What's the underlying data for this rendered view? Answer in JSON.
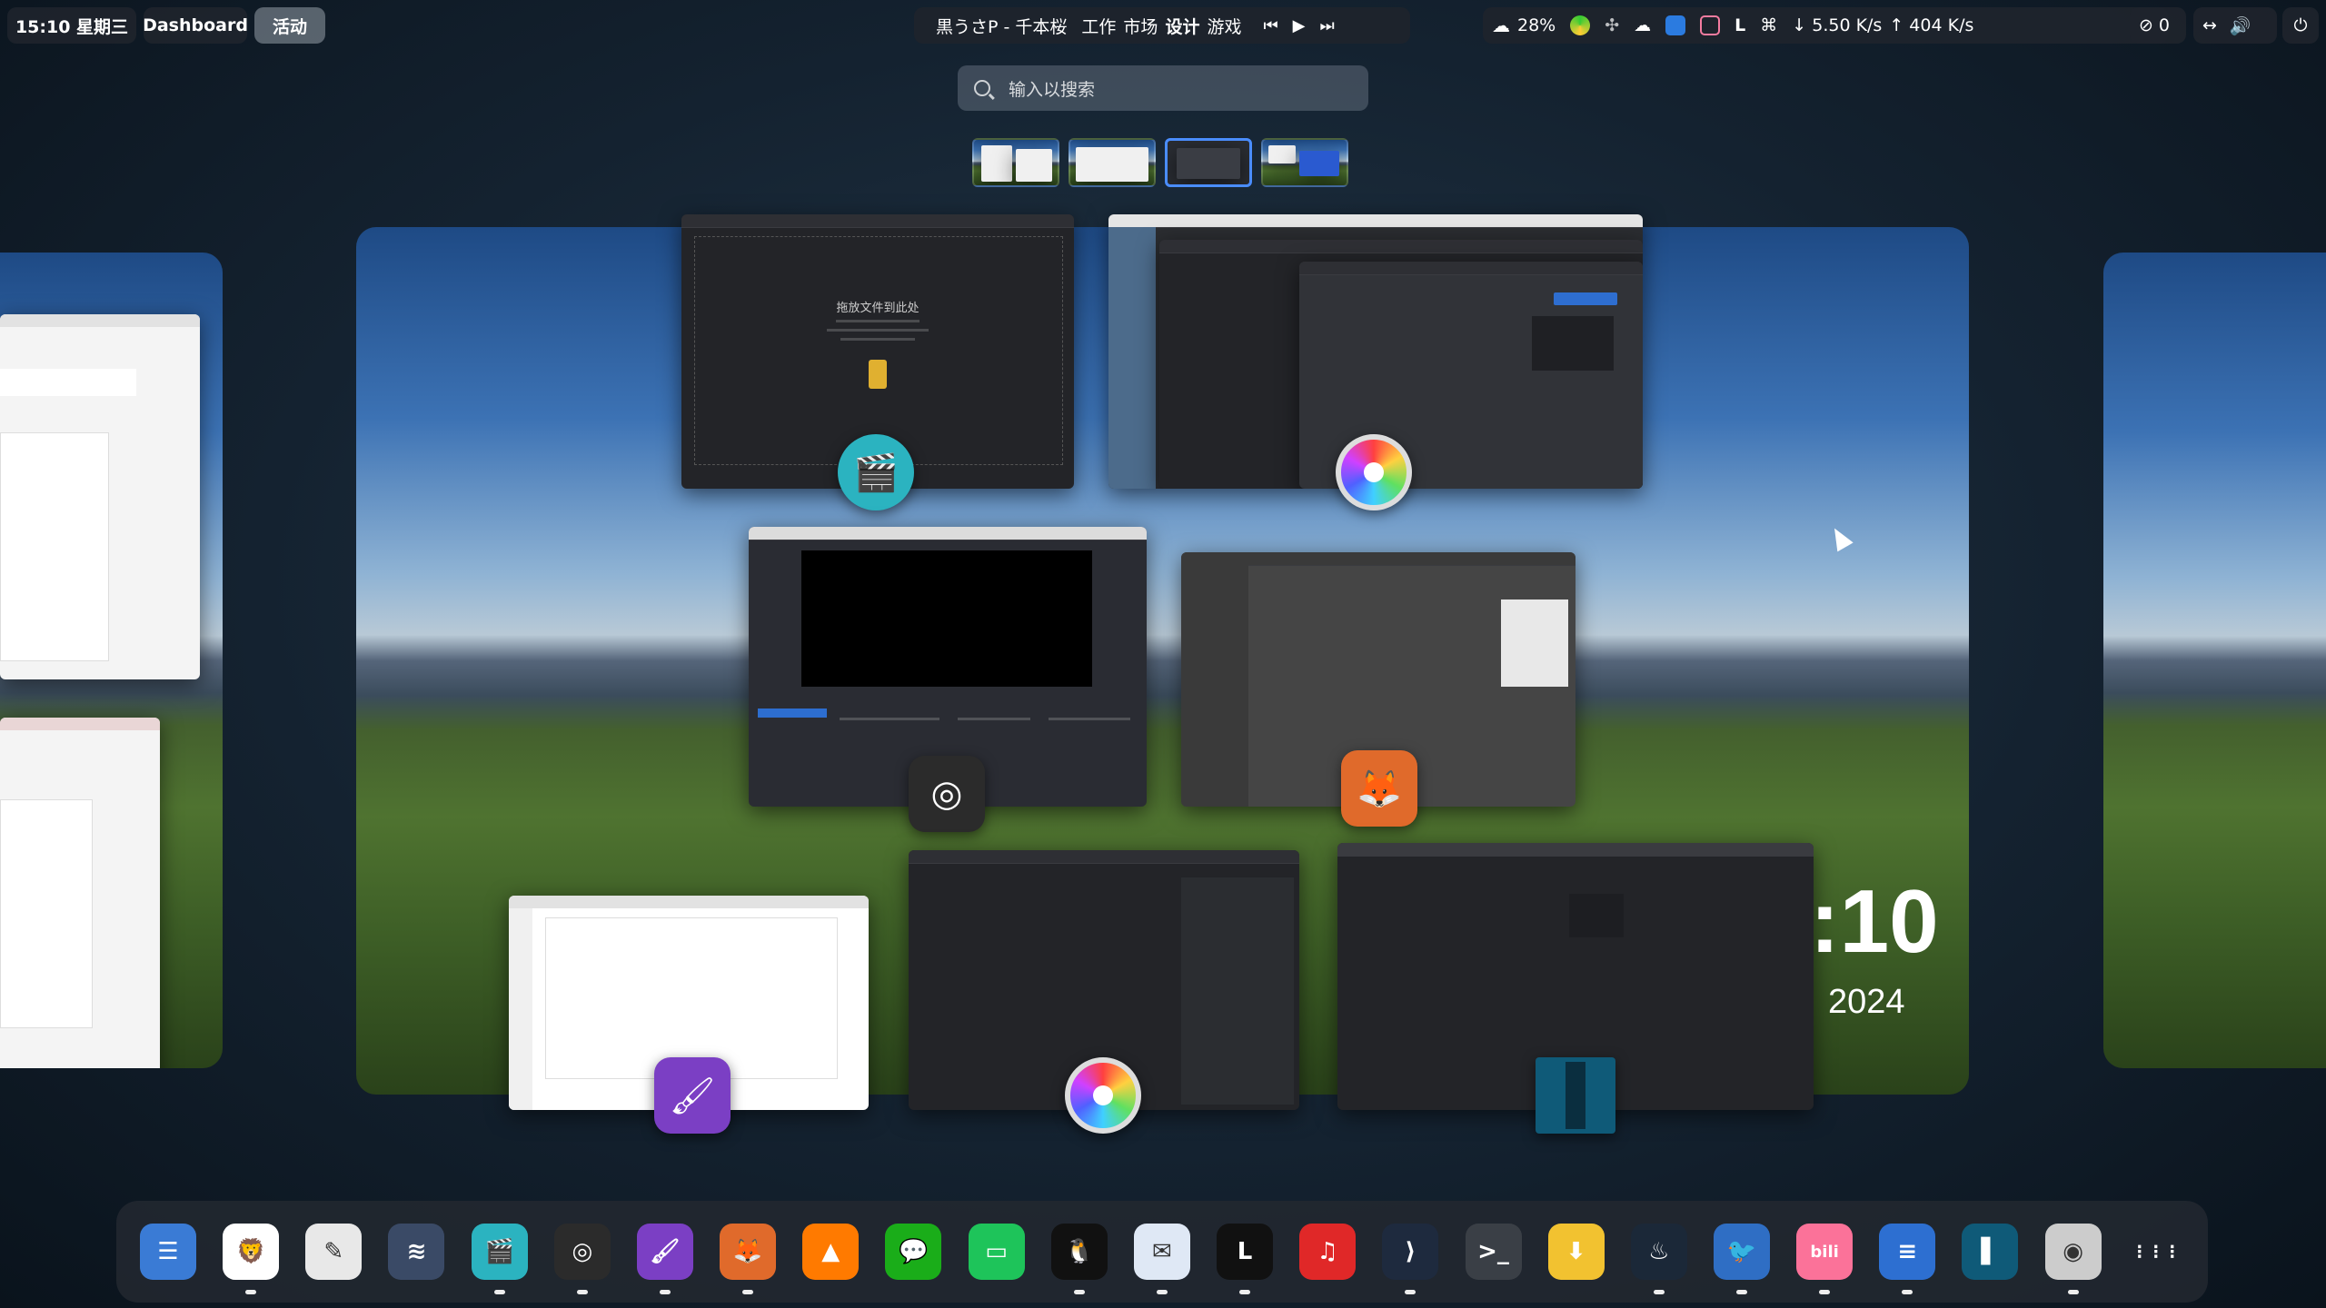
{
  "topbar": {
    "datetime": "15:10 星期三",
    "dashboard": "Dashboard",
    "activities": "活动",
    "now_playing": "黒うさP - 千本桜",
    "workspaces": [
      "工作",
      "市场",
      "设计",
      "游戏"
    ],
    "battery": "28%",
    "net_down": "↓ 5.50 K/s",
    "net_up": "↑ 404 K/s",
    "notif_count": "0"
  },
  "search": {
    "placeholder": "输入以搜索"
  },
  "clock": {
    "time": ":10",
    "year": "2024"
  },
  "windows": {
    "video_editor": {
      "drop_title": "拖放文件到此处",
      "icon": "clapperboard-icon"
    }
  },
  "dock": {
    "items": [
      {
        "name": "finder-icon",
        "color": "#3a7bd5",
        "glyph": "☰",
        "running": false
      },
      {
        "name": "brave-icon",
        "color": "#ffffff",
        "glyph": "🦁",
        "running": true
      },
      {
        "name": "notes-icon",
        "color": "#e8e8e8",
        "glyph": "✎",
        "running": false
      },
      {
        "name": "layers-icon",
        "color": "#3a4a66",
        "glyph": "≋",
        "running": false
      },
      {
        "name": "video-editor-icon",
        "color": "#2bb3c0",
        "glyph": "🎬",
        "running": true
      },
      {
        "name": "obs-icon",
        "color": "#2b2b2b",
        "glyph": "◎",
        "running": true
      },
      {
        "name": "krita-icon",
        "color": "#7b3fc4",
        "glyph": "🖌",
        "running": true
      },
      {
        "name": "gimp-icon",
        "color": "#e06a2b",
        "glyph": "🦊",
        "running": true
      },
      {
        "name": "vlc-icon",
        "color": "#ff7a00",
        "glyph": "▲",
        "running": false
      },
      {
        "name": "wechat-icon",
        "color": "#1aad19",
        "glyph": "💬",
        "running": false
      },
      {
        "name": "files-icon",
        "color": "#1ec45a",
        "glyph": "▭",
        "running": false
      },
      {
        "name": "qq-icon",
        "color": "#111111",
        "glyph": "🐧",
        "running": true
      },
      {
        "name": "mail-icon",
        "color": "#dfe8f5",
        "glyph": "✉",
        "running": true
      },
      {
        "name": "lark-icon",
        "color": "#111111",
        "glyph": "L",
        "running": true
      },
      {
        "name": "netease-music-icon",
        "color": "#e02828",
        "glyph": "♫",
        "running": false
      },
      {
        "name": "vscode-icon",
        "color": "#1e2a3e",
        "glyph": "⟩",
        "running": true
      },
      {
        "name": "terminal-icon",
        "color": "#3a3f46",
        "glyph": ">_",
        "running": false
      },
      {
        "name": "installer-icon",
        "color": "#f2c230",
        "glyph": "⬇",
        "running": false
      },
      {
        "name": "steam-icon",
        "color": "#1b2838",
        "glyph": "♨",
        "running": true
      },
      {
        "name": "game-icon",
        "color": "#2f6ec4",
        "glyph": "🐦",
        "running": true
      },
      {
        "name": "bilibili-icon",
        "color": "#fb7299",
        "glyph": "bili",
        "running": true
      },
      {
        "name": "stack-icon",
        "color": "#2d6fd1",
        "glyph": "≡",
        "running": true
      },
      {
        "name": "panel-icon",
        "color": "#0f5a78",
        "glyph": "▌",
        "running": false
      },
      {
        "name": "color-picker-icon",
        "color": "#cccccc",
        "glyph": "◉",
        "running": true
      },
      {
        "name": "app-grid-icon",
        "color": "transparent",
        "glyph": "⋮⋮⋮",
        "running": false
      }
    ]
  }
}
